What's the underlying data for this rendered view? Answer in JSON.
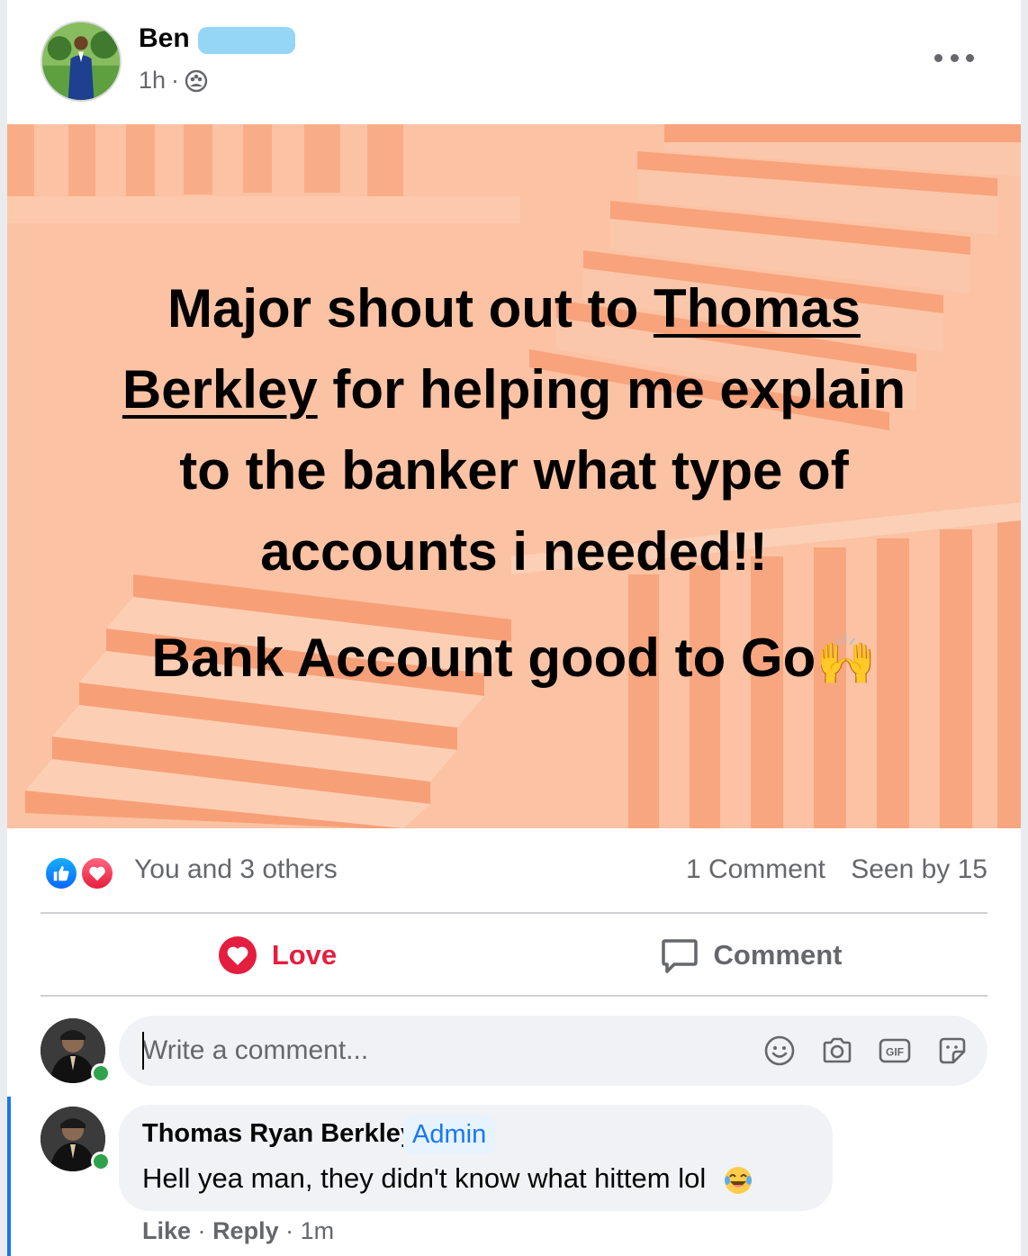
{
  "post": {
    "author_name": "Ben",
    "timestamp": "1h",
    "separator": "·",
    "privacy_icon": "group-icon",
    "more_icon": "more-options-icon",
    "text_lines": {
      "line1_prefix": "Major shout out to ",
      "line1_mention": "Thomas",
      "line2_mention": "Berkley",
      "line2_suffix": " for helping me explain",
      "line3": "to the banker what type of",
      "line4": "accounts i needed!!",
      "line5": "Bank Account good to Go",
      "line5_emoji": "🙌"
    },
    "background_color": "#f9b795"
  },
  "reactions": {
    "icons": [
      "like-reaction-icon",
      "love-reaction-icon"
    ],
    "summary": "You and 3 others",
    "comment_count": "1 Comment",
    "seen_by": "Seen by 15"
  },
  "actions": {
    "love_label": "Love",
    "comment_label": "Comment",
    "love_color": "#e41e3f"
  },
  "composer": {
    "placeholder": "Write a comment...",
    "icons": [
      "emoji-icon",
      "camera-icon",
      "gif-icon",
      "sticker-icon"
    ],
    "gif_label": "GIF"
  },
  "comments": [
    {
      "author": "Thomas Ryan Berkley",
      "badge": "Admin",
      "text": "Hell yea man, they didn't know what hittem lol",
      "emoji_icon": "laughing-emoji-icon",
      "like_label": "Like",
      "reply_label": "Reply",
      "time": "1m",
      "separator": "·"
    }
  ]
}
